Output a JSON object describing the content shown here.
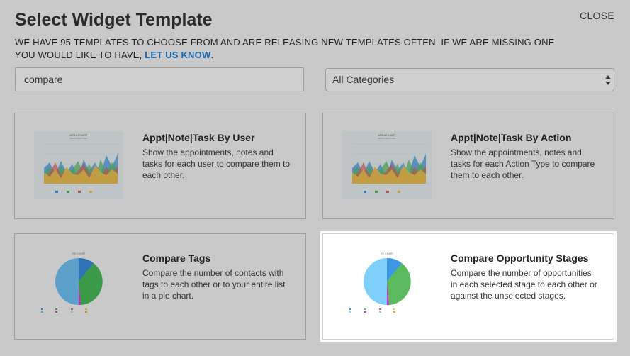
{
  "dialog": {
    "title": "Select Widget Template",
    "close_label": "CLOSE",
    "description_prefix": "WE HAVE 95 TEMPLATES TO CHOOSE FROM AND ARE RELEASING NEW TEMPLATES OFTEN. IF WE ARE MISSING ONE YOU WOULD LIKE TO HAVE, ",
    "description_link": "LET US KNOW",
    "description_suffix": "."
  },
  "search": {
    "value": "compare"
  },
  "category_select": {
    "value": "All Categories"
  },
  "thumbnail_labels": {
    "area_title": "AREA CHART",
    "area_subtitle": "SIMPLE AREA CHART",
    "pie_title": "PIE CHART"
  },
  "templates": [
    {
      "name": "Appt|Note|Task By User",
      "description": "Show the appointments, notes and tasks for each user to compare them to each other.",
      "thumbnail": "area-chart",
      "selected": false
    },
    {
      "name": "Appt|Note|Task By Action",
      "description": "Show the appointments, notes and tasks for each Action Type to compare them to each other.",
      "thumbnail": "area-chart",
      "selected": false
    },
    {
      "name": "Compare Tags",
      "description": "Compare the number of contacts with tags to each other or to your entire list in a pie chart.",
      "thumbnail": "pie-chart",
      "selected": false
    },
    {
      "name": "Compare Opportunity Stages",
      "description": "Compare the number of opportunities in each selected stage to each other or against the unselected stages.",
      "thumbnail": "pie-chart",
      "selected": true
    }
  ],
  "colors": {
    "link": "#1a6aad",
    "overlay": "#c9c9c9",
    "card_selected": "#ffffff"
  }
}
